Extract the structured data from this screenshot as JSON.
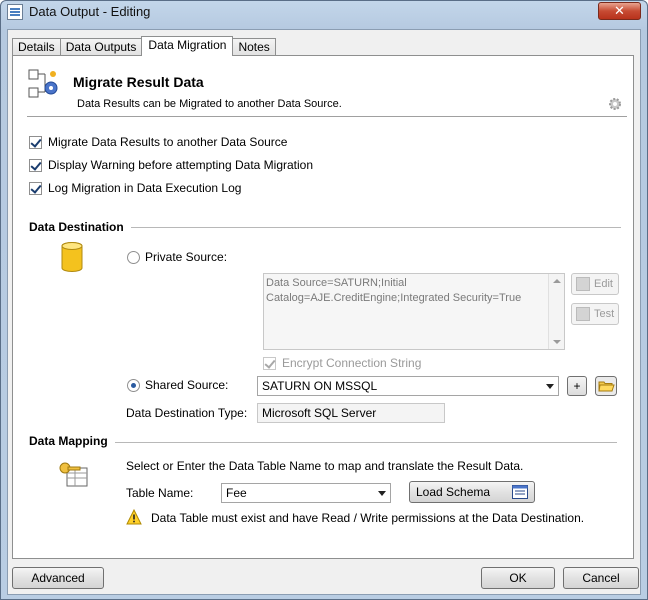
{
  "window": {
    "title": "Data Output - Editing",
    "close_label": "✕"
  },
  "tabs": [
    {
      "label": "Details"
    },
    {
      "label": "Data Outputs"
    },
    {
      "label": "Data Migration",
      "active": true
    },
    {
      "label": "Notes"
    }
  ],
  "header": {
    "title": "Migrate Result Data",
    "subtitle": "Data Results can be Migrated to another Data Source."
  },
  "options": [
    {
      "label": "Migrate Data Results to another Data Source",
      "checked": true
    },
    {
      "label": "Display Warning before attempting Data Migration",
      "checked": true
    },
    {
      "label": "Log Migration in Data Execution Log",
      "checked": true
    }
  ],
  "destination": {
    "section_title": "Data Destination",
    "private_label": "Private Source:",
    "private_selected": false,
    "connection_string": "Data Source=SATURN;Initial Catalog=AJE.CreditEngine;Integrated Security=True",
    "edit_label": "Edit",
    "test_label": "Test",
    "encrypt_label": "Encrypt Connection String",
    "encrypt_checked": true,
    "shared_label": "Shared Source:",
    "shared_selected": true,
    "shared_value": "SATURN ON MSSQL",
    "add_label": "+",
    "type_label": "Data Destination Type:",
    "type_value": "Microsoft SQL Server"
  },
  "mapping": {
    "section_title": "Data Mapping",
    "instructions": "Select or Enter the Data Table Name to map and translate the Result Data.",
    "table_name_label": "Table Name:",
    "table_name_value": "Fee",
    "load_schema_label": "Load Schema",
    "warning": "Data Table must exist and have Read / Write permissions at the Data Destination."
  },
  "footer": {
    "advanced_label": "Advanced",
    "ok_label": "OK",
    "cancel_label": "Cancel"
  }
}
